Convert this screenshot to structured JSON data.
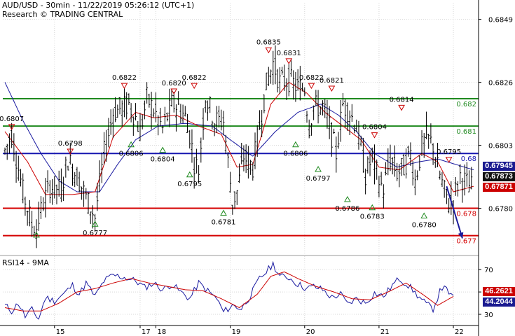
{
  "header": {
    "title": "AUD/USD - 30min - 11/22/2019 05:26:12 (UTC+1)",
    "subtitle": "Research © TRADING CENTRAL",
    "rsi_title": "RSI14 - 9MA"
  },
  "colors": {
    "price": "#000000",
    "ma_fast": "#cc0000",
    "ma_slow": "#1a1aa0",
    "resistance": "#1f8a1f",
    "pivot": "#1515b0",
    "support": "#d40000",
    "arrow": "#1a1a9a",
    "tag_blue": "#1a1a90",
    "tag_black": "#111111",
    "tag_red": "#cc0000"
  },
  "chart_data": [
    {
      "type": "line",
      "title": "AUD/USD - 30min - 11/22/2019 05:26:12 (UTC+1)",
      "ylim": [
        0.6763,
        0.6855
      ],
      "y_ticks": [
        "0.6849",
        "0.6826",
        "0.6803",
        "0.6780"
      ],
      "y_tick_values": [
        0.6849,
        0.6826,
        0.6803,
        0.678
      ],
      "x_ticks": [
        {
          "label": "15",
          "bar": 22
        },
        {
          "label": "17",
          "bar": 60
        },
        {
          "label": "18",
          "bar": 67
        },
        {
          "label": "19",
          "bar": 100
        },
        {
          "label": "20",
          "bar": 133
        },
        {
          "label": "21",
          "bar": 166
        },
        {
          "label": "22",
          "bar": 199
        }
      ],
      "bar_count": 208,
      "grid": true,
      "price_key_points": [
        [
          0,
          0.6801
        ],
        [
          3,
          0.6807
        ],
        [
          8,
          0.6786
        ],
        [
          12,
          0.6774
        ],
        [
          14,
          0.6773
        ],
        [
          17,
          0.6782
        ],
        [
          20,
          0.6788
        ],
        [
          25,
          0.6787
        ],
        [
          28,
          0.6798
        ],
        [
          33,
          0.679
        ],
        [
          37,
          0.6782
        ],
        [
          40,
          0.6777
        ],
        [
          44,
          0.68
        ],
        [
          48,
          0.6815
        ],
        [
          55,
          0.6818
        ],
        [
          58,
          0.6813
        ],
        [
          60,
          0.6808
        ],
        [
          63,
          0.682
        ],
        [
          66,
          0.6816
        ],
        [
          70,
          0.6809
        ],
        [
          74,
          0.6818
        ],
        [
          77,
          0.6817
        ],
        [
          81,
          0.6812
        ],
        [
          84,
          0.6797
        ],
        [
          86,
          0.6794
        ],
        [
          89,
          0.6821
        ],
        [
          93,
          0.6812
        ],
        [
          97,
          0.6812
        ],
        [
          101,
          0.6782
        ],
        [
          103,
          0.6786
        ],
        [
          106,
          0.6799
        ],
        [
          110,
          0.6795
        ],
        [
          113,
          0.681
        ],
        [
          116,
          0.6825
        ],
        [
          119,
          0.6833
        ],
        [
          122,
          0.6826
        ],
        [
          126,
          0.6827
        ],
        [
          130,
          0.6824
        ],
        [
          133,
          0.6824
        ],
        [
          135,
          0.681
        ],
        [
          137,
          0.6817
        ],
        [
          141,
          0.6817
        ],
        [
          144,
          0.681
        ],
        [
          147,
          0.68
        ],
        [
          150,
          0.6818
        ],
        [
          153,
          0.6815
        ],
        [
          156,
          0.681
        ],
        [
          158,
          0.6802
        ],
        [
          160,
          0.6792
        ],
        [
          163,
          0.6799
        ],
        [
          166,
          0.679
        ],
        [
          168,
          0.6787
        ],
        [
          171,
          0.6798
        ],
        [
          174,
          0.6793
        ],
        [
          177,
          0.6795
        ],
        [
          180,
          0.68
        ],
        [
          182,
          0.679
        ],
        [
          185,
          0.6802
        ],
        [
          187,
          0.6806
        ],
        [
          190,
          0.6803
        ],
        [
          192,
          0.6795
        ],
        [
          195,
          0.6786
        ],
        [
          197,
          0.6782
        ],
        [
          199,
          0.6783
        ],
        [
          202,
          0.6792
        ],
        [
          205,
          0.6789
        ],
        [
          208,
          0.6787
        ]
      ],
      "price_volatility": 0.00055,
      "ma_fast_key_points": [
        [
          0,
          0.6808
        ],
        [
          10,
          0.6797
        ],
        [
          18,
          0.6785
        ],
        [
          30,
          0.6785
        ],
        [
          40,
          0.6786
        ],
        [
          48,
          0.6806
        ],
        [
          58,
          0.6815
        ],
        [
          66,
          0.6813
        ],
        [
          76,
          0.6814
        ],
        [
          86,
          0.681
        ],
        [
          96,
          0.6807
        ],
        [
          103,
          0.6795
        ],
        [
          110,
          0.6796
        ],
        [
          118,
          0.6818
        ],
        [
          126,
          0.6826
        ],
        [
          134,
          0.6822
        ],
        [
          142,
          0.6815
        ],
        [
          150,
          0.681
        ],
        [
          158,
          0.6805
        ],
        [
          166,
          0.6795
        ],
        [
          175,
          0.6794
        ],
        [
          185,
          0.68
        ],
        [
          192,
          0.6797
        ],
        [
          199,
          0.6786
        ],
        [
          208,
          0.6788
        ]
      ],
      "ma_slow_key_points": [
        [
          0,
          0.6826
        ],
        [
          8,
          0.6812
        ],
        [
          16,
          0.68
        ],
        [
          24,
          0.679
        ],
        [
          32,
          0.6786
        ],
        [
          42,
          0.6786
        ],
        [
          50,
          0.6796
        ],
        [
          58,
          0.6805
        ],
        [
          68,
          0.681
        ],
        [
          80,
          0.6811
        ],
        [
          92,
          0.681
        ],
        [
          100,
          0.6805
        ],
        [
          110,
          0.6799
        ],
        [
          120,
          0.6808
        ],
        [
          130,
          0.6815
        ],
        [
          140,
          0.6818
        ],
        [
          148,
          0.6814
        ],
        [
          156,
          0.6808
        ],
        [
          164,
          0.68
        ],
        [
          174,
          0.6795
        ],
        [
          184,
          0.6797
        ],
        [
          192,
          0.6798
        ],
        [
          200,
          0.6796
        ],
        [
          208,
          0.6794
        ]
      ],
      "levels": [
        {
          "value": 0.682,
          "label": "0.682",
          "kind": "resistance"
        },
        {
          "value": 0.681,
          "label": "0.681",
          "kind": "resistance"
        },
        {
          "value": 0.68,
          "label": "0.68",
          "kind": "pivot"
        },
        {
          "value": 0.678,
          "label": "0.678",
          "kind": "support"
        },
        {
          "value": 0.677,
          "label": "0.677",
          "kind": "support"
        }
      ],
      "highs": [
        {
          "bar": 3,
          "value": 0.6807,
          "label": "0.6807"
        },
        {
          "bar": 29,
          "value": 0.6798,
          "label": "0.6798"
        },
        {
          "bar": 53,
          "value": 0.6822,
          "label": "0.6822"
        },
        {
          "bar": 75,
          "value": 0.682,
          "label": "0.6820"
        },
        {
          "bar": 84,
          "value": 0.6822,
          "label": "0.6822"
        },
        {
          "bar": 117,
          "value": 0.6835,
          "label": "0.6835"
        },
        {
          "bar": 126,
          "value": 0.6831,
          "label": "0.6831"
        },
        {
          "bar": 136,
          "value": 0.6822,
          "label": "0.6822"
        },
        {
          "bar": 145,
          "value": 0.6821,
          "label": "0.6821"
        },
        {
          "bar": 164,
          "value": 0.6804,
          "label": "0.6804"
        },
        {
          "bar": 176,
          "value": 0.6814,
          "label": "0.6814"
        },
        {
          "bar": 197,
          "value": 0.6795,
          "label": "0.6795"
        }
      ],
      "lows": [
        {
          "bar": 14,
          "value": 0.6773,
          "label": ""
        },
        {
          "bar": 40,
          "value": 0.6777,
          "label": "0.6777"
        },
        {
          "bar": 56,
          "value": 0.6806,
          "label": "0.6806"
        },
        {
          "bar": 70,
          "value": 0.6804,
          "label": "0.6804"
        },
        {
          "bar": 82,
          "value": 0.6795,
          "label": "0.6795"
        },
        {
          "bar": 97,
          "value": 0.6781,
          "label": "0.6781"
        },
        {
          "bar": 129,
          "value": 0.6806,
          "label": "0.6806"
        },
        {
          "bar": 139,
          "value": 0.6797,
          "label": "0.6797"
        },
        {
          "bar": 152,
          "value": 0.6786,
          "label": "0.6786"
        },
        {
          "bar": 163,
          "value": 0.6783,
          "label": "0.6783"
        },
        {
          "bar": 186,
          "value": 0.678,
          "label": "0.6780"
        }
      ],
      "forecast_arrow": {
        "from": [
          196,
          0.6788
        ],
        "to": [
          203,
          0.6769
        ]
      },
      "price_tags": [
        {
          "label": "0.67945",
          "color": "tag_blue"
        },
        {
          "label": "0.67873",
          "color": "tag_black"
        },
        {
          "label": "0.67871",
          "color": "tag_red"
        }
      ]
    },
    {
      "type": "line",
      "title": "RSI14 - 9MA",
      "ylim": [
        20,
        82
      ],
      "y_ticks": [
        "70",
        "50",
        "30"
      ],
      "y_tick_values": [
        70,
        50,
        30
      ],
      "rsi_key_points": [
        [
          0,
          38
        ],
        [
          3,
          33
        ],
        [
          6,
          40
        ],
        [
          9,
          28
        ],
        [
          12,
          34
        ],
        [
          15,
          26
        ],
        [
          18,
          45
        ],
        [
          22,
          42
        ],
        [
          26,
          48
        ],
        [
          30,
          56
        ],
        [
          33,
          48
        ],
        [
          36,
          58
        ],
        [
          40,
          46
        ],
        [
          44,
          60
        ],
        [
          48,
          65
        ],
        [
          53,
          63
        ],
        [
          58,
          60
        ],
        [
          62,
          54
        ],
        [
          66,
          58
        ],
        [
          70,
          52
        ],
        [
          74,
          57
        ],
        [
          78,
          50
        ],
        [
          82,
          44
        ],
        [
          86,
          58
        ],
        [
          90,
          51
        ],
        [
          94,
          44
        ],
        [
          97,
          32
        ],
        [
          101,
          38
        ],
        [
          105,
          35
        ],
        [
          109,
          47
        ],
        [
          113,
          62
        ],
        [
          116,
          68
        ],
        [
          119,
          75
        ],
        [
          122,
          64
        ],
        [
          126,
          63
        ],
        [
          130,
          57
        ],
        [
          134,
          53
        ],
        [
          137,
          55
        ],
        [
          141,
          52
        ],
        [
          145,
          45
        ],
        [
          149,
          48
        ],
        [
          152,
          39
        ],
        [
          156,
          44
        ],
        [
          160,
          40
        ],
        [
          164,
          49
        ],
        [
          168,
          46
        ],
        [
          172,
          56
        ],
        [
          175,
          62
        ],
        [
          179,
          56
        ],
        [
          183,
          47
        ],
        [
          187,
          39
        ],
        [
          190,
          35
        ],
        [
          193,
          50
        ],
        [
          195,
          57
        ],
        [
          197,
          46
        ],
        [
          199,
          48
        ]
      ],
      "rsi_volatility": 3.2,
      "ma_key_points": [
        [
          0,
          36
        ],
        [
          8,
          33
        ],
        [
          16,
          33
        ],
        [
          24,
          40
        ],
        [
          32,
          50
        ],
        [
          40,
          53
        ],
        [
          48,
          58
        ],
        [
          56,
          62
        ],
        [
          64,
          58
        ],
        [
          72,
          55
        ],
        [
          80,
          52
        ],
        [
          88,
          51
        ],
        [
          96,
          44
        ],
        [
          104,
          36
        ],
        [
          112,
          48
        ],
        [
          118,
          64
        ],
        [
          124,
          68
        ],
        [
          130,
          62
        ],
        [
          138,
          55
        ],
        [
          146,
          50
        ],
        [
          154,
          44
        ],
        [
          162,
          43
        ],
        [
          170,
          50
        ],
        [
          178,
          58
        ],
        [
          186,
          47
        ],
        [
          192,
          38
        ],
        [
          199,
          46
        ]
      ],
      "tags": [
        {
          "label": "46.2621",
          "color": "tag_red"
        },
        {
          "label": "44.2044",
          "color": "tag_blue"
        }
      ]
    }
  ]
}
